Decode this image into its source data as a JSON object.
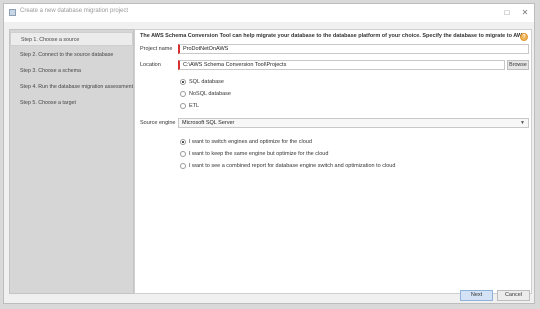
{
  "window": {
    "title": "Create a new database migration project",
    "minimize_icon": "minimize-icon",
    "maximize_icon": "maximize-icon",
    "close_icon": "close-icon"
  },
  "sidebar": {
    "steps": [
      {
        "label": "Step 1. Choose a source",
        "active": true
      },
      {
        "label": "Step 2. Connect to the source database",
        "active": false
      },
      {
        "label": "Step 3. Choose a schema",
        "active": false
      },
      {
        "label": "Step 4. Run the database migration assessment",
        "active": false
      },
      {
        "label": "Step 5. Choose a target",
        "active": false
      }
    ]
  },
  "main": {
    "header": "The AWS Schema Conversion Tool can help migrate your database to the database platform of your choice. Specify the database to migrate to AWS.",
    "help_icon": "help-icon",
    "project_name": {
      "label": "Project name",
      "value": "ProDotNetOnAWS"
    },
    "location": {
      "label": "Location",
      "value": "C:\\AWS Schema Conversion Tool\\Projects",
      "browse_label": "Browse"
    },
    "db_types": [
      {
        "label": "SQL database",
        "selected": true
      },
      {
        "label": "NoSQL database",
        "selected": false
      },
      {
        "label": "ETL",
        "selected": false
      }
    ],
    "source_engine": {
      "label": "Source engine",
      "value": "Microsoft SQL Server"
    },
    "options": [
      {
        "label": "I want to switch engines and optimize for the cloud",
        "selected": true
      },
      {
        "label": "I want to keep the same engine but optimize for the cloud",
        "selected": false
      },
      {
        "label": "I want to see a combined report for database engine switch and optimization to cloud",
        "selected": false
      }
    ]
  },
  "footer": {
    "next_label": "Next",
    "cancel_label": "Cancel"
  },
  "colors": {
    "accent": "#8fb2da",
    "required_marker": "#d83030"
  }
}
